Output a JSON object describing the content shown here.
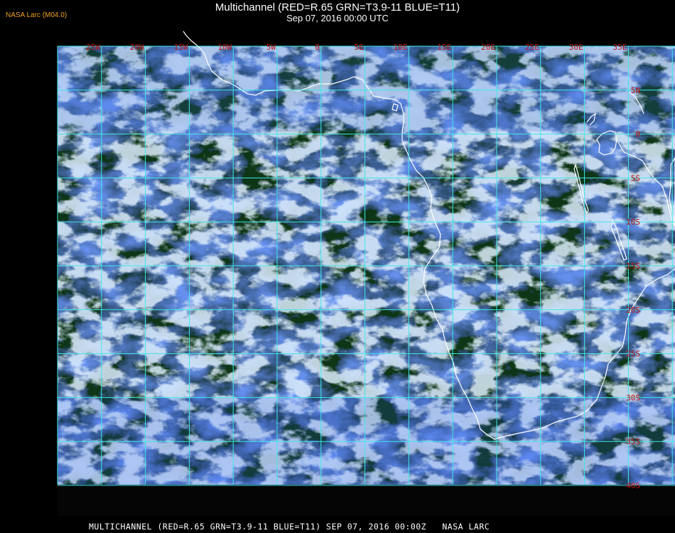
{
  "header": {
    "source_tag": "NASA Larc (M04.0)",
    "title": "Multichannel (RED=R.65 GRN=T3.9-11 BLUE=T11)",
    "subtitle": "Sep 07, 2016 00:00 UTC"
  },
  "footer": {
    "caption": "MULTICHANNEL (RED=R.65 GRN=T3.9-11 BLUE=T11) SEP 07, 2016 00:00Z   NASA LARC"
  },
  "map": {
    "lon_labels": [
      "25W",
      "20W",
      "15W",
      "10W",
      "5W",
      "0",
      "5E",
      "10E",
      "15E",
      "20E",
      "25E",
      "30E",
      "35E"
    ],
    "lat_labels": [
      "5N",
      "0",
      "5S",
      "10S",
      "15S",
      "20S",
      "25S",
      "30S",
      "35S",
      "40S"
    ],
    "colors": {
      "grid": "#40e8e8",
      "label": "#c01010",
      "coast": "#ffffff",
      "ocean_dark": "#0e3418",
      "cloud_blue": "#2a58d8",
      "cloud_bright": "#b8d8f8"
    }
  }
}
